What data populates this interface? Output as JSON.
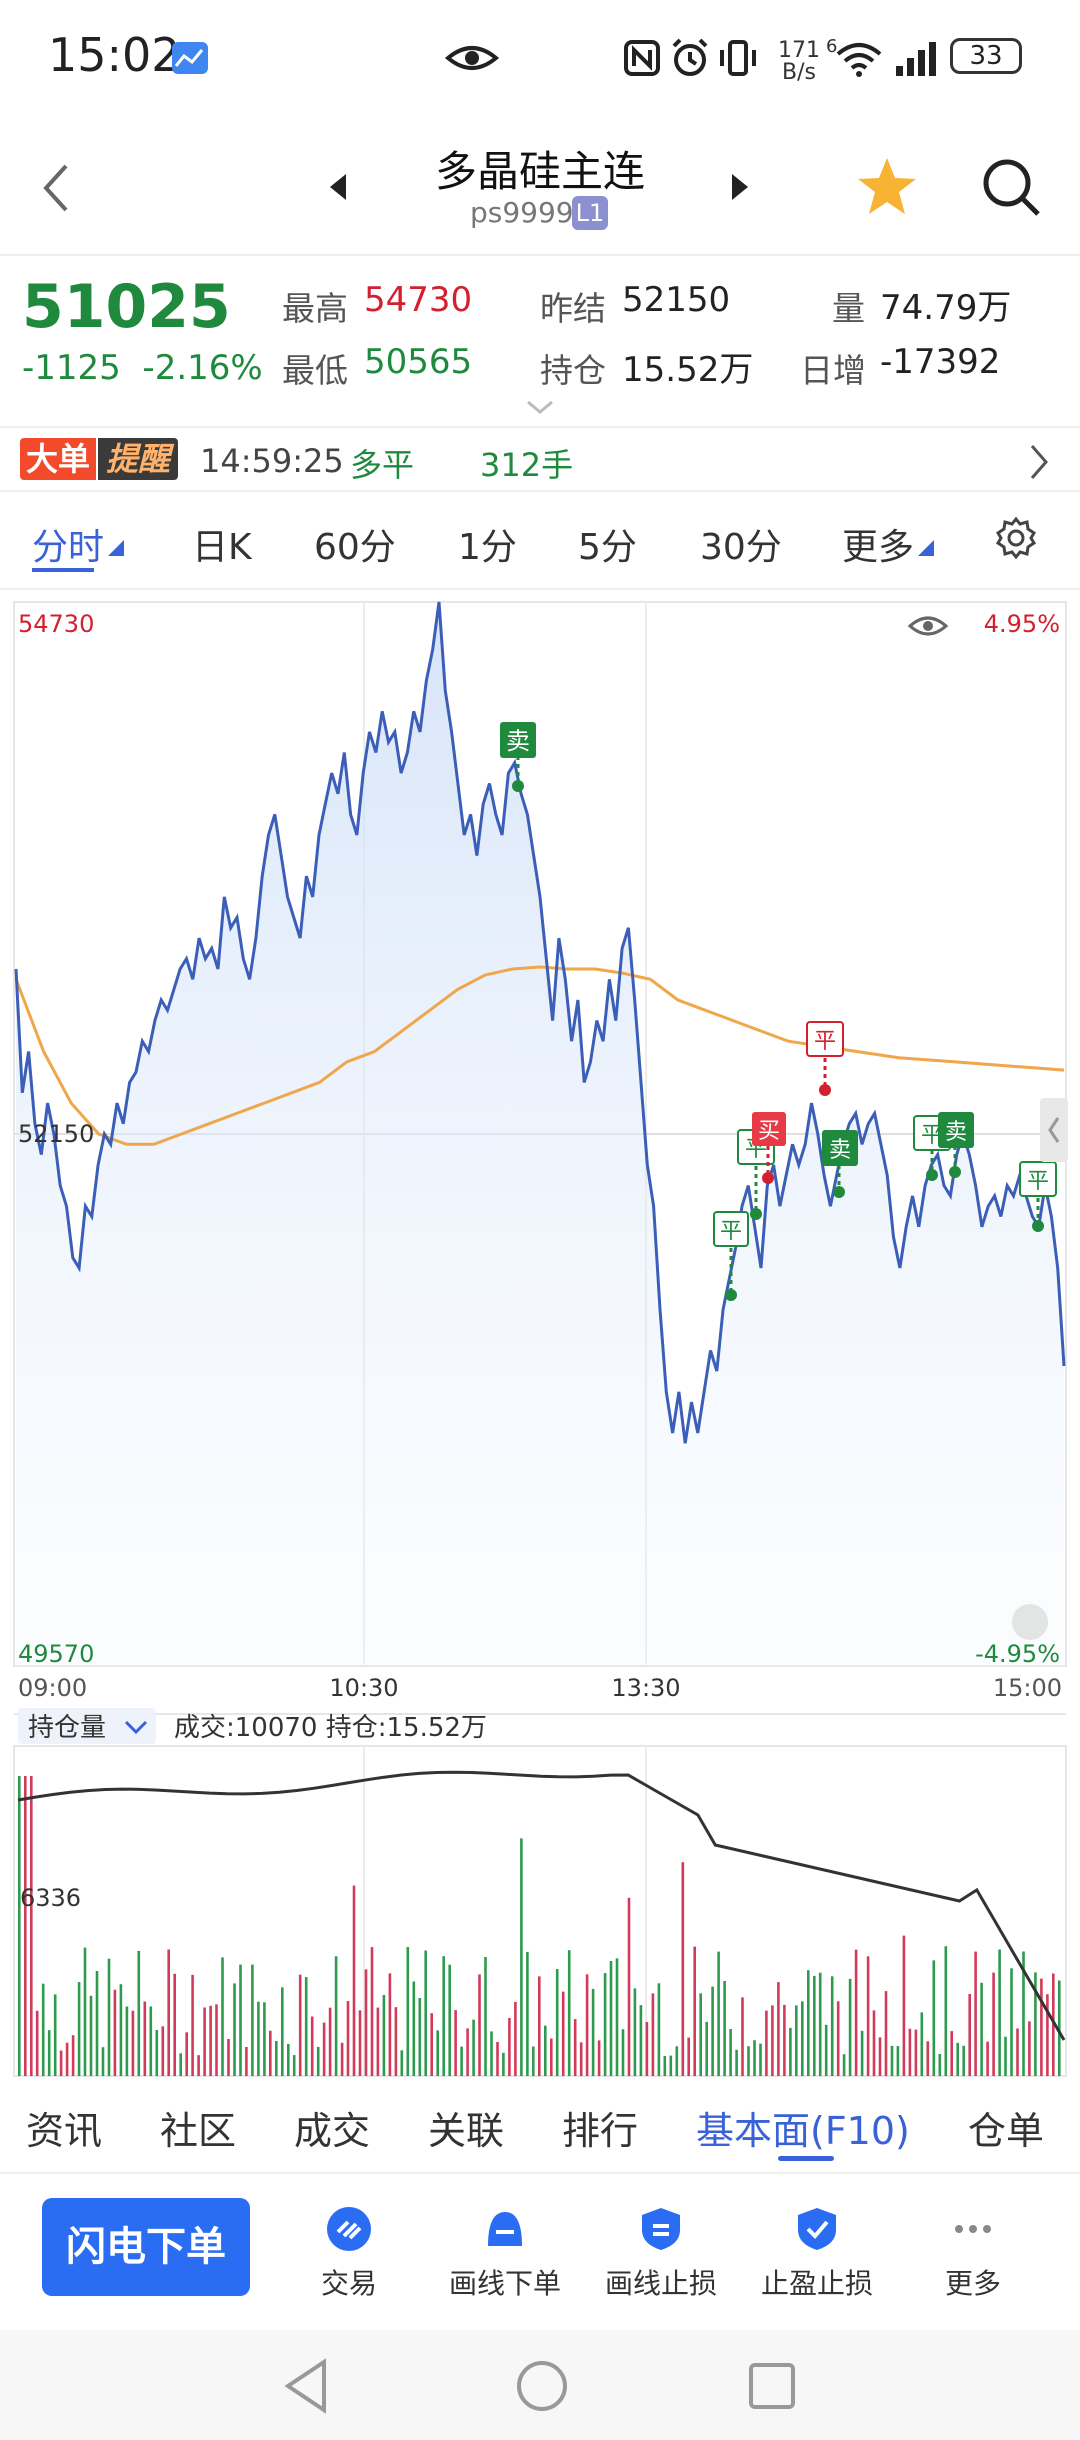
{
  "status_bar": {
    "time": "15:02",
    "net_speed_value": "171",
    "net_speed_unit": "B/s",
    "signal_label": "6",
    "battery": "33"
  },
  "header": {
    "title": "多晶硅主连",
    "code": "ps9999",
    "level_badge": "L1"
  },
  "quote": {
    "price": "51025",
    "change": "-1125",
    "change_pct": "-2.16%",
    "high_label": "最高",
    "high": "54730",
    "low_label": "最低",
    "low": "50565",
    "prev_settle_label": "昨结",
    "prev_settle": "52150",
    "open_interest_label": "持仓",
    "open_interest": "15.52万",
    "volume_label": "量",
    "volume": "74.79万",
    "daily_add_label": "日增",
    "daily_add": "-17392"
  },
  "alert": {
    "tag_part1": "大单",
    "tag_part2": "提醒",
    "time": "14:59:25",
    "action": "多平",
    "lots": "312手"
  },
  "tabs": [
    "分时",
    "日K",
    "60分",
    "1分",
    "5分",
    "30分",
    "更多"
  ],
  "active_tab": "分时",
  "chart_labels": {
    "y_top": "54730",
    "y_mid": "52150",
    "y_bottom": "49570",
    "pct_top": "4.95%",
    "pct_bottom": "-4.95%",
    "x_ticks": [
      "09:00",
      "10:30",
      "13:30",
      "15:00"
    ],
    "sub_selector": "持仓量",
    "sub_info": "成交:10070 持仓:15.52万",
    "sub_axis": "6336"
  },
  "chart_data": {
    "type": "line",
    "ylim": [
      49570,
      54730
    ],
    "reference": 52150,
    "series": [
      {
        "values": [
          52950,
          52350,
          52550,
          52200,
          52050,
          52300,
          52150,
          51900,
          51800,
          51550,
          51500,
          51800,
          51750,
          52000,
          52150,
          52100,
          52300,
          52200,
          52400,
          52450,
          52600,
          52550,
          52700,
          52800,
          52750,
          52850,
          52950,
          53000,
          52900,
          53100,
          53000,
          53050,
          52950,
          53300,
          53150,
          53200,
          53000,
          52900,
          53100,
          53400,
          53600,
          53700,
          53500,
          53300,
          53200,
          53100,
          53400,
          53300,
          53600,
          53750,
          53900,
          53800,
          54000,
          53700,
          53600,
          53900,
          54100,
          54000,
          54200,
          54050,
          54100,
          53900,
          54000,
          54200,
          54100,
          54350,
          54500,
          54730,
          54300,
          54100,
          53850,
          53600,
          53700,
          53500,
          53750,
          53850,
          53700,
          53600,
          53900,
          53950,
          53800,
          53700,
          53500,
          53300,
          53000,
          52700,
          53100,
          52900,
          52600,
          52800,
          52400,
          52500,
          52700,
          52600,
          52900,
          52700,
          53050,
          53150,
          52800,
          52400,
          52000,
          51800,
          51300,
          50900,
          50700,
          50900,
          50650,
          50850,
          50700,
          50900,
          51100,
          51000,
          51300,
          51450,
          51600,
          51800,
          51900,
          51700,
          51500,
          51900,
          52000,
          51800,
          51950,
          52100,
          52000,
          52100,
          52300,
          52150,
          51950,
          51800,
          51950,
          52100,
          52200,
          52250,
          52100,
          52200,
          52250,
          52100,
          51950,
          51650,
          51500,
          51700,
          51850,
          51700,
          51900,
          52000,
          52050,
          51900,
          51850,
          52050,
          52150,
          52050,
          51900,
          51700,
          51800,
          51850,
          51750,
          51900,
          51850,
          51950,
          51850,
          51750,
          51700,
          51900,
          51750,
          51500,
          51025
        ]
      },
      {
        "values": [
          52900,
          52550,
          52300,
          52150,
          52100,
          52100,
          52150,
          52200,
          52250,
          52300,
          52350,
          52400,
          52500,
          52550,
          52650,
          52750,
          52850,
          52920,
          52950,
          52960,
          52950,
          52950,
          52930,
          52900,
          52800,
          52750,
          52700,
          52650,
          52600,
          52580,
          52560,
          52540,
          52520,
          52510,
          52500,
          52490,
          52480,
          52470,
          52460
        ]
      }
    ]
  },
  "bottom_tabs": [
    "资讯",
    "社区",
    "成交",
    "关联",
    "排行",
    "基本面(F10)",
    "仓单"
  ],
  "active_bottom_tab": "基本面(F10)",
  "actions": {
    "flash_order": "闪电下单",
    "items": [
      "交易",
      "画线下单",
      "画线止损",
      "止盈止损",
      "更多"
    ]
  }
}
